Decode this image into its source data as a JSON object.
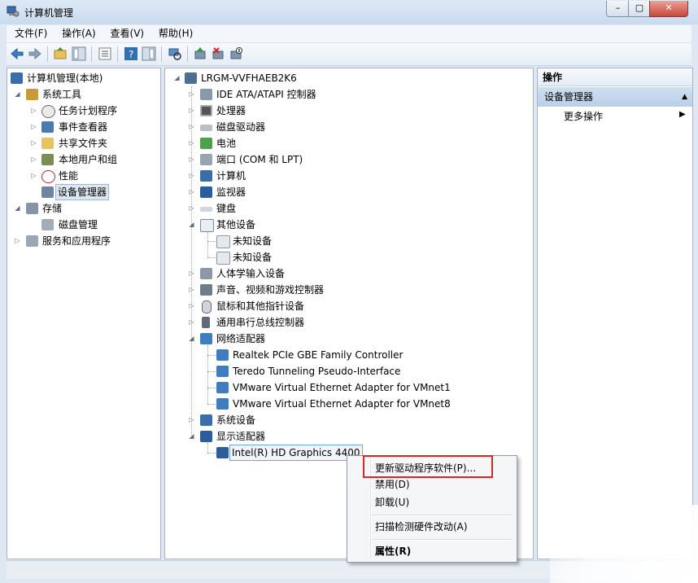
{
  "window": {
    "title": "计算机管理"
  },
  "titlebar": {
    "min": "–",
    "max": "▢",
    "close": "✕"
  },
  "menu": [
    "文件(F)",
    "操作(A)",
    "查看(V)",
    "帮助(H)"
  ],
  "left_tree": {
    "root": "计算机管理(本地)",
    "system_tools": "系统工具",
    "items": [
      "任务计划程序",
      "事件查看器",
      "共享文件夹",
      "本地用户和组",
      "性能",
      "设备管理器"
    ],
    "storage": "存储",
    "disk_mgmt": "磁盘管理",
    "services": "服务和应用程序"
  },
  "device_tree": {
    "computer": "LRGM-VVFHAEB2K6",
    "categories": [
      "IDE ATA/ATAPI 控制器",
      "处理器",
      "磁盘驱动器",
      "电池",
      "端口 (COM 和 LPT)",
      "计算机",
      "监视器",
      "键盘",
      "其他设备"
    ],
    "other_devices": [
      "未知设备",
      "未知设备"
    ],
    "categories2": [
      "人体学输入设备",
      "声音、视频和游戏控制器",
      "鼠标和其他指针设备",
      "通用串行总线控制器",
      "网络适配器"
    ],
    "network_adapters": [
      "Realtek PCIe GBE Family Controller",
      "Teredo Tunneling Pseudo-Interface",
      "VMware Virtual Ethernet Adapter for VMnet1",
      "VMware Virtual Ethernet Adapter for VMnet8"
    ],
    "categories3": [
      "系统设备",
      "显示适配器"
    ],
    "display_adapter": "Intel(R) HD Graphics 4400"
  },
  "actions": {
    "header": "操作",
    "section": "设备管理器",
    "more": "更多操作"
  },
  "context_menu": {
    "update": "更新驱动程序软件(P)...",
    "disable": "禁用(D)",
    "uninstall": "卸载(U)",
    "scan": "扫描检测硬件改动(A)",
    "properties": "属性(R)"
  },
  "colors": {
    "highlight": "#d9271e",
    "selection": "#dde7f3"
  }
}
